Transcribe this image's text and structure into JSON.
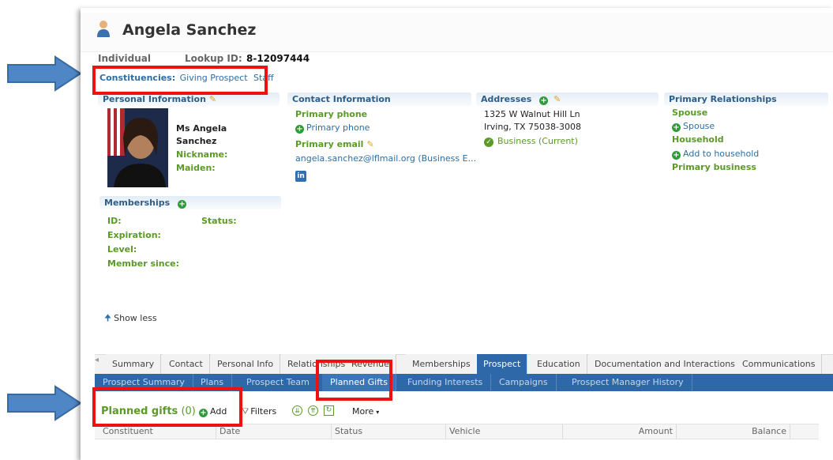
{
  "header": {
    "name": "Angela Sanchez",
    "type": "Individual",
    "lookup_label": "Lookup ID:",
    "lookup_value": "8-12097444"
  },
  "constituencies": {
    "label": "Constituencies:",
    "items": [
      "Giving Prospect",
      "Staff"
    ]
  },
  "personal": {
    "title": "Personal Information",
    "name_line1": "Ms Angela",
    "name_line2": "Sanchez",
    "nickname": "Nickname:",
    "maiden": "Maiden:"
  },
  "contact": {
    "title": "Contact Information",
    "phone_label": "Primary phone",
    "phone_add": "Primary phone",
    "email_label": "Primary email",
    "email_value": "angela.sanchez@lflmail.org (Business E...",
    "linkedin": "in"
  },
  "addresses": {
    "title": "Addresses",
    "line1": "1325 W Walnut Hill Ln",
    "line2": "Irving, TX 75038-3008",
    "status": "Business (Current)"
  },
  "relationships": {
    "title": "Primary Relationships",
    "spouse_label": "Spouse",
    "spouse_add": "Spouse",
    "household_label": "Household",
    "household_add": "Add to household",
    "business_label": "Primary business"
  },
  "memberships": {
    "title": "Memberships",
    "id": "ID:",
    "status": "Status:",
    "expiration": "Expiration:",
    "level": "Level:",
    "member_since": "Member since:"
  },
  "show_less": "Show less",
  "tabs": [
    "Summary",
    "Contact",
    "Personal Info",
    "Relationships",
    "Revenue",
    "Memberships",
    "Prospect",
    "Education",
    "Documentation and Interactions",
    "Communications"
  ],
  "subtabs": [
    "Prospect Summary",
    "Plans",
    "Prospect Team",
    "Planned Gifts",
    "Funding Interests",
    "Campaigns",
    "Prospect Manager History"
  ],
  "grid": {
    "title": "Planned gifts",
    "count": "(0)",
    "add": "Add",
    "filters": "Filters",
    "more": "More",
    "columns": [
      "Constituent",
      "Date",
      "Status",
      "Vehicle",
      "Amount",
      "Balance"
    ]
  },
  "colors": {
    "accent_blue": "#2f68a8",
    "green": "#5b9a27",
    "red_highlight": "#ee1111",
    "arrow_blue": "#4f86c6"
  }
}
